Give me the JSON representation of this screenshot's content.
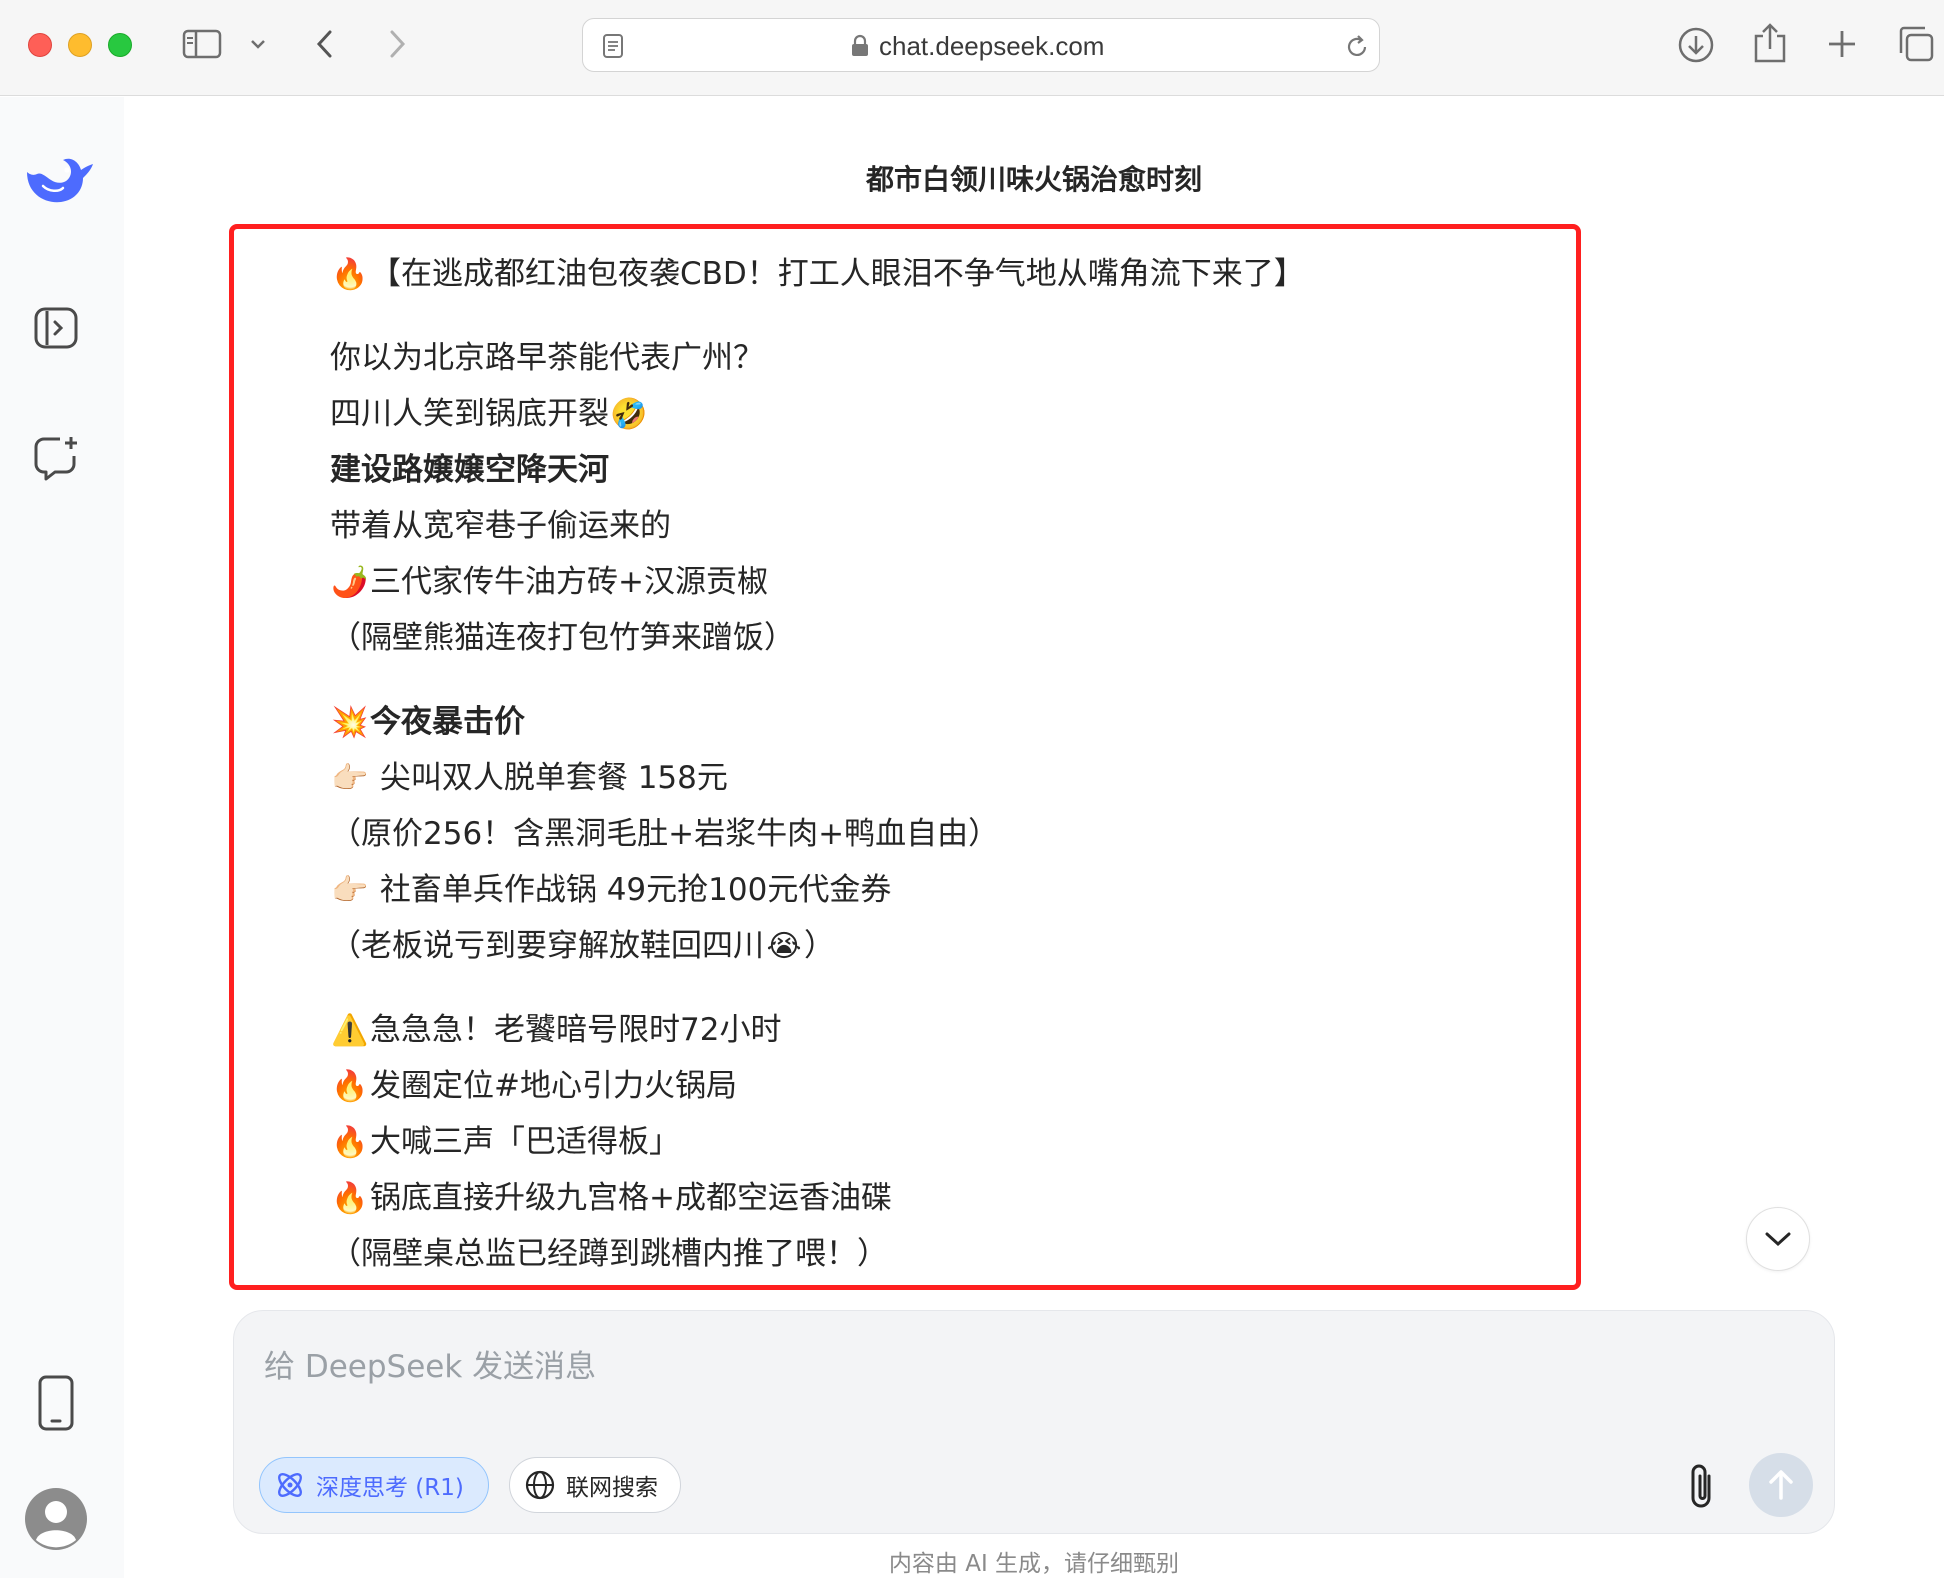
{
  "browser": {
    "url": "chat.deepseek.com",
    "icons": [
      "sidebar-toggle-icon",
      "chevron-down-icon",
      "back-icon",
      "forward-icon",
      "reader-icon",
      "lock-icon",
      "reload-icon",
      "download-icon",
      "share-icon",
      "new-tab-icon",
      "tab-overview-icon"
    ]
  },
  "sidebar": {
    "icons": [
      "deepseek-logo",
      "open-sidebar-icon",
      "new-chat-icon",
      "mobile-app-icon",
      "user-avatar"
    ]
  },
  "chat": {
    "title": "都市白领川味火锅治愈时刻",
    "message": {
      "headline_emoji": "🔥",
      "headline": "【在逃成都红油包夜袭CBD！打工人眼泪不争气地从嘴角流下来了】",
      "p1": {
        "l1": "你以为北京路早茶能代表广州？",
        "l2": "四川人笑到锅底开裂",
        "l2_emoji": "🤣",
        "l3": "建设路嬢嬢空降天河",
        "l4": "带着从宽窄巷子偷运来的",
        "l5_emoji": "🌶️",
        "l5": "三代家传牛油方砖+汉源贡椒",
        "l6": "（隔壁熊猫连夜打包竹笋来蹭饭）"
      },
      "p2": {
        "l1_emoji": "💥",
        "l1": "今夜暴击价",
        "l2_emoji": "👉🏻",
        "l2": "尖叫双人脱单套餐 158元",
        "l3": "（原价256！含黑洞毛肚+岩浆牛肉+鸭血自由）",
        "l4_emoji": "👉🏻",
        "l4": "社畜单兵作战锅 49元抢100元代金券",
        "l5": "（老板说亏到要穿解放鞋回四川",
        "l5_emoji": "😭",
        "l5_end": "）"
      },
      "p3": {
        "l1_emoji": "⚠️",
        "l1": "急急急！老饕暗号限时72小时",
        "l2_emoji": "🔥",
        "l2": "发圈定位#地心引力火锅局",
        "l3_emoji": "🔥",
        "l3": "大喊三声「巴适得板」",
        "l4_emoji": "🔥",
        "l4": "锅底直接升级九宫格+成都空运香油碟",
        "l5": "（隔壁桌总监已经蹲到跳槽内推了喂！）"
      }
    }
  },
  "composer": {
    "placeholder": "给 DeepSeek 发送消息",
    "deep_think_label": "深度思考 (R1)",
    "web_search_label": "联网搜索",
    "disclaimer": "内容由 AI 生成，请仔细甄别"
  },
  "colors": {
    "accent": "#4d6bfe",
    "highlight_border": "#ff1f1f",
    "sidebar_bg": "#f9fafb",
    "composer_bg": "#f3f4f6"
  }
}
